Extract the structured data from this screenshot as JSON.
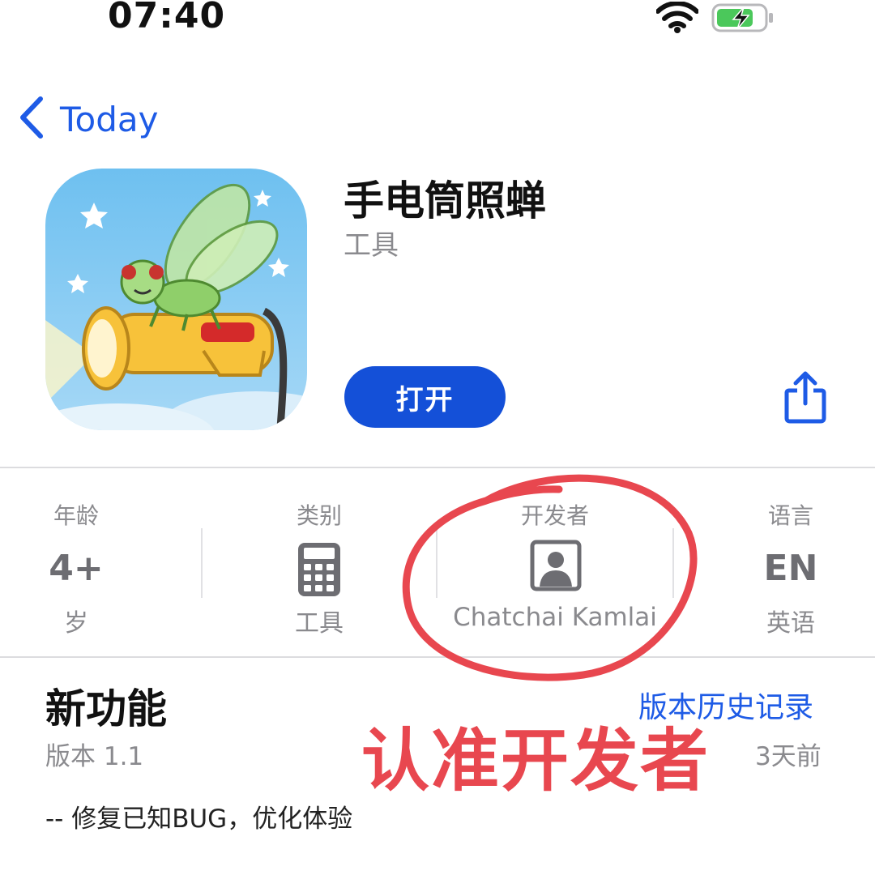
{
  "status_bar": {
    "time": "07:40",
    "wifi_icon": "wifi-icon",
    "battery_icon": "battery-charging-icon"
  },
  "nav": {
    "back_label": "Today",
    "back_icon": "chevron-left-icon"
  },
  "app": {
    "name": "手电筒照蝉",
    "category": "工具",
    "open_label": "打开",
    "share_icon": "share-icon"
  },
  "info": {
    "age": {
      "header": "年龄",
      "value": "4+",
      "sub": "岁"
    },
    "category": {
      "header": "类别",
      "icon": "calculator-icon",
      "sub": "工具"
    },
    "developer": {
      "header": "开发者",
      "icon": "person-portrait-icon",
      "sub": "Chatchai Kamlai"
    },
    "language": {
      "header": "语言",
      "value": "EN",
      "sub": "英语"
    }
  },
  "whats_new": {
    "title": "新功能",
    "history_link": "版本历史记录",
    "version": "版本 1.1",
    "ago": "3天前",
    "notes": "-- 修复已知BUG，优化体验"
  },
  "annotation": {
    "text": "认准开发者",
    "color": "#e8474f"
  },
  "colors": {
    "accent": "#1450d8",
    "link": "#1e5be6"
  }
}
